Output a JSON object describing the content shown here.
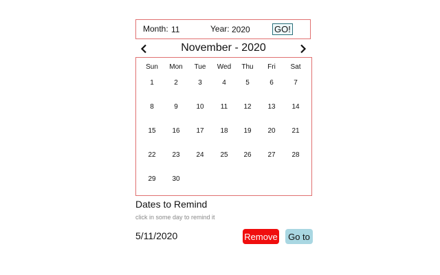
{
  "selector": {
    "month_label": "Month:",
    "month_value": "11",
    "year_label": "Year:",
    "year_value": "2020",
    "go_label": "GO!"
  },
  "calendar": {
    "title": "November - 2020",
    "prev_icon": "chevron-left-icon",
    "next_icon": "chevron-right-icon",
    "weekdays": [
      "Sun",
      "Mon",
      "Tue",
      "Wed",
      "Thu",
      "Fri",
      "Sat"
    ],
    "weeks": [
      [
        "1",
        "2",
        "3",
        "4",
        "5",
        "6",
        "7"
      ],
      [
        "8",
        "9",
        "10",
        "11",
        "12",
        "13",
        "14"
      ],
      [
        "15",
        "16",
        "17",
        "18",
        "19",
        "20",
        "21"
      ],
      [
        "22",
        "23",
        "24",
        "25",
        "26",
        "27",
        "28"
      ],
      [
        "29",
        "30",
        "",
        "",
        "",
        "",
        ""
      ]
    ]
  },
  "reminders": {
    "title": "Dates to Remind",
    "hint": "click in some day to remind it",
    "items": [
      {
        "date": "5/11/2020",
        "remove_label": "Remove",
        "goto_label": "Go to"
      }
    ]
  },
  "colors": {
    "border": "#e07070",
    "remove_button": "#f00e0e",
    "goto_button": "#a9d7e2",
    "go_button_border": "#2a6f7a"
  }
}
